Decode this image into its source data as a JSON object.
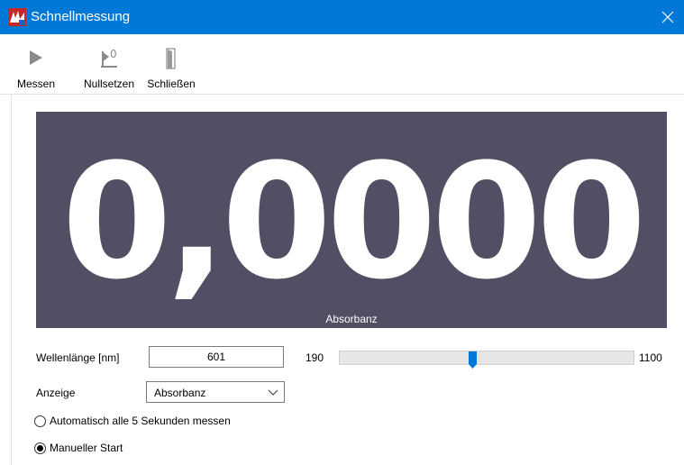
{
  "window": {
    "title": "Schnellmessung",
    "app_icon": "uv-spectrometer-icon",
    "close_icon": "close-icon",
    "accent_color": "#0078d7"
  },
  "toolbar": {
    "measure": {
      "label": "Messen",
      "icon": "play-icon"
    },
    "zero": {
      "label": "Nullsetzen",
      "icon": "zero-icon"
    },
    "close": {
      "label": "Schließen",
      "icon": "door-icon"
    }
  },
  "display": {
    "value": "0,0000",
    "unit_label": "Absorbanz",
    "background": "#504f63"
  },
  "wavelength": {
    "label": "Wellenlänge [nm]",
    "value": "601",
    "min_label": "190",
    "max_label": "1100",
    "min": 190,
    "max": 1100,
    "current": 601
  },
  "display_mode": {
    "label": "Anzeige",
    "selected": "Absorbanz"
  },
  "measure_mode": {
    "auto_label": "Automatisch alle 5 Sekunden messen",
    "manual_label": "Manueller Start",
    "selected": "manual"
  }
}
